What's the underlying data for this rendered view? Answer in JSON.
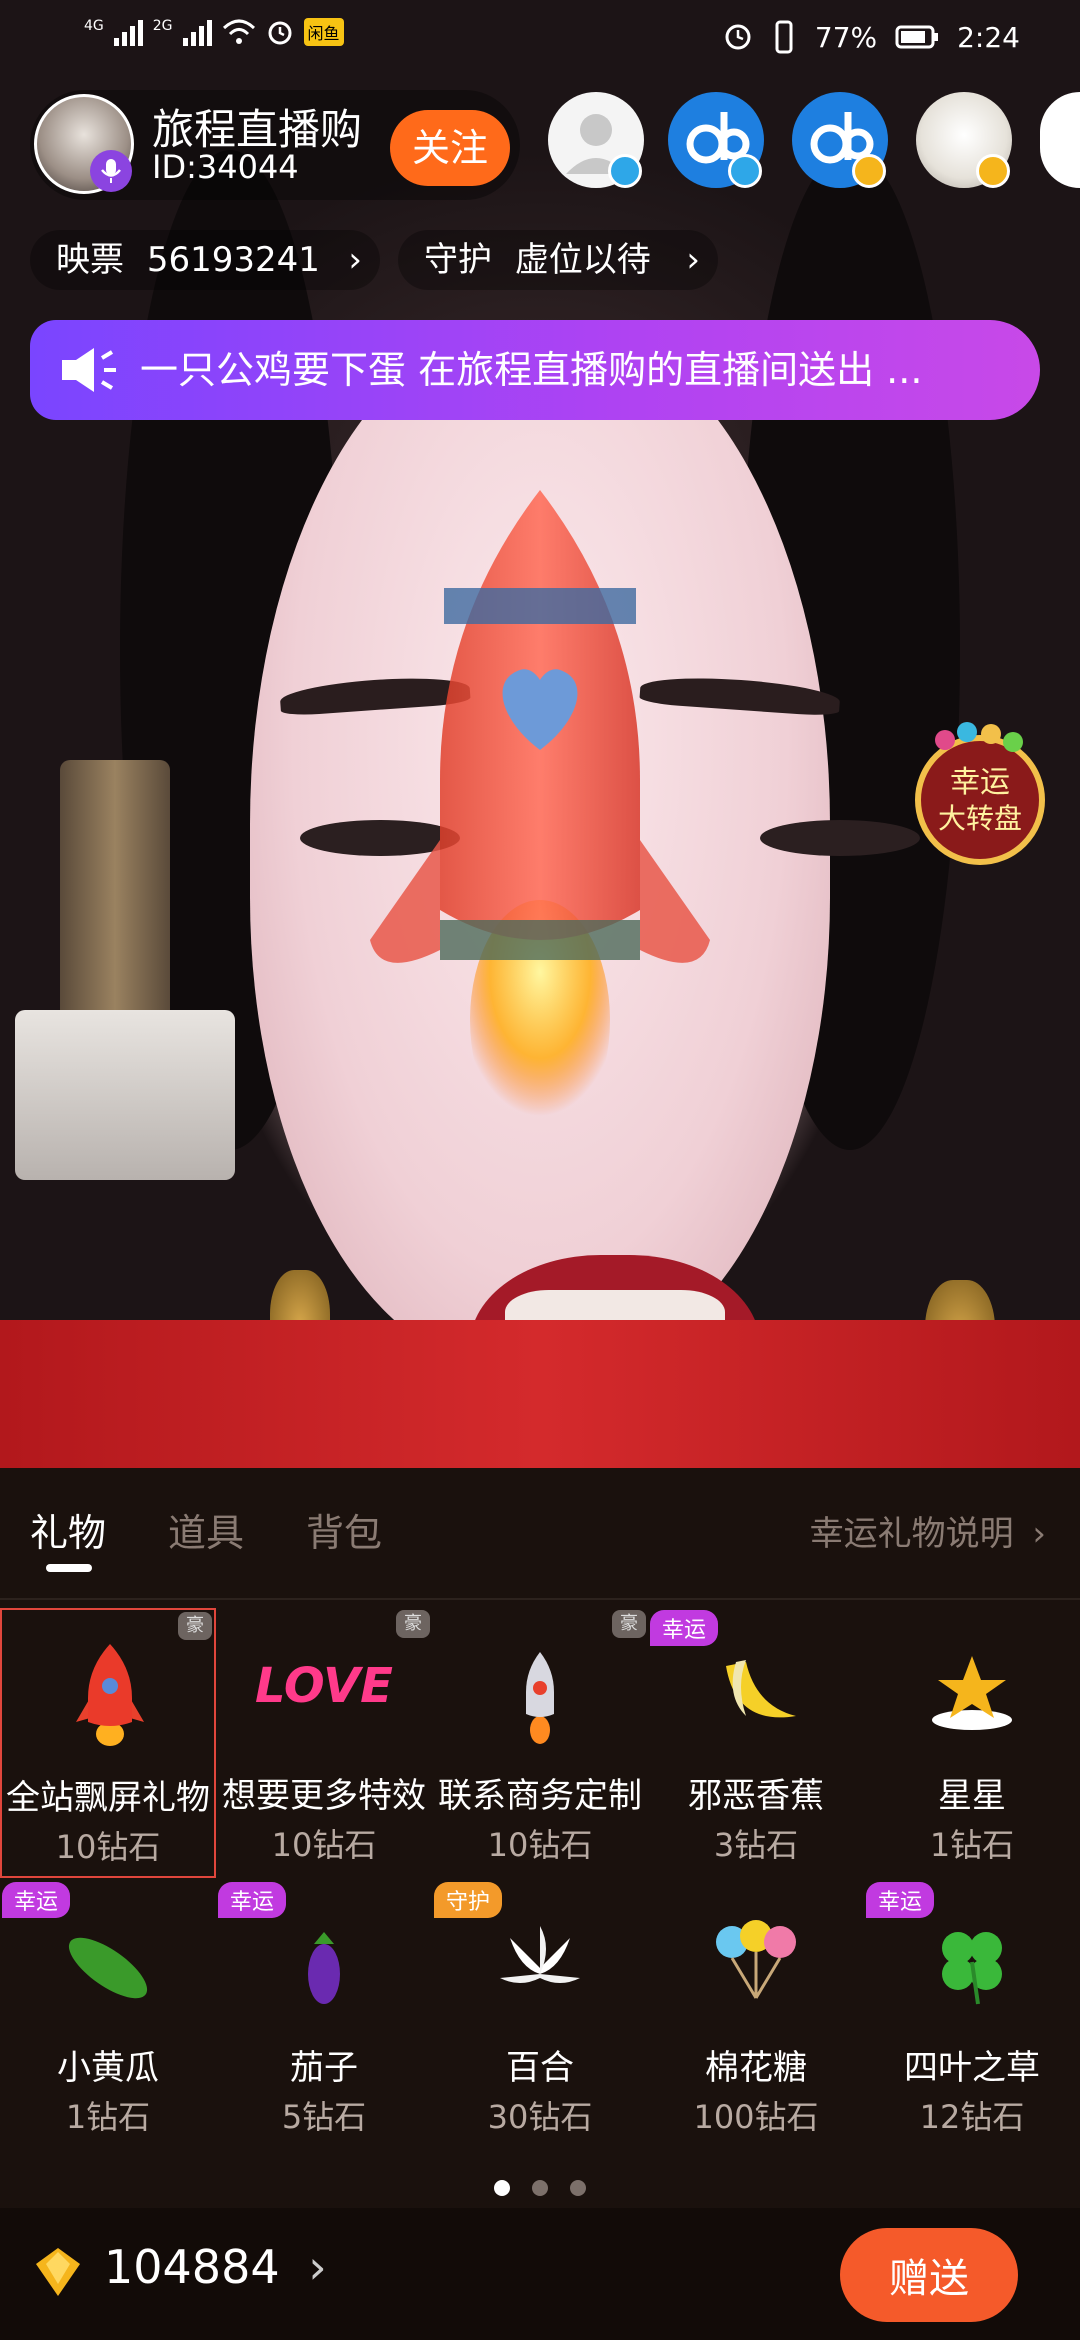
{
  "status_bar": {
    "network_1": "4G",
    "network_2": "2G",
    "app_badge": "闲鱼",
    "battery": "77%",
    "time": "2:24"
  },
  "host": {
    "name": "旅程直播购",
    "id": "ID:34044",
    "follow_label": "关注"
  },
  "stats": {
    "tickets_label": "映票",
    "tickets_value": "56193241",
    "guard_label": "守护",
    "guard_value": "虚位以待"
  },
  "banner": {
    "text": "一只公鸡要下蛋 在旅程直播购的直播间送出 ..."
  },
  "lucky_wheel": {
    "line1": "幸运",
    "line2": "大转盘"
  },
  "gift_panel": {
    "tabs": [
      {
        "label": "礼物"
      },
      {
        "label": "道具"
      },
      {
        "label": "背包"
      }
    ],
    "help_link": "幸运礼物说明",
    "tag_lucky": "幸运",
    "tag_guard": "守护",
    "tag_hao": "豪",
    "gifts_row1": [
      {
        "name": "全站飘屏礼物",
        "price": "10钻石"
      },
      {
        "name": "想要更多特效",
        "price": "10钻石"
      },
      {
        "name": "联系商务定制",
        "price": "10钻石"
      },
      {
        "name": "邪恶香蕉",
        "price": "3钻石"
      },
      {
        "name": "星星",
        "price": "1钻石"
      }
    ],
    "gifts_row2": [
      {
        "name": "小黄瓜",
        "price": "1钻石"
      },
      {
        "name": "茄子",
        "price": "5钻石"
      },
      {
        "name": "百合",
        "price": "30钻石"
      },
      {
        "name": "棉花糖",
        "price": "100钻石"
      },
      {
        "name": "四叶之草",
        "price": "12钻石"
      }
    ],
    "love_text": "LOVE",
    "balance": "104884",
    "send_label": "赠送"
  },
  "colors": {
    "follow": "#ff6a1a",
    "send": "#f55a2a",
    "banner_start": "#7a45ff",
    "banner_end": "#c849e8",
    "lucky_tag": "#c13ae0",
    "guard_tag": "#f39a2a"
  }
}
